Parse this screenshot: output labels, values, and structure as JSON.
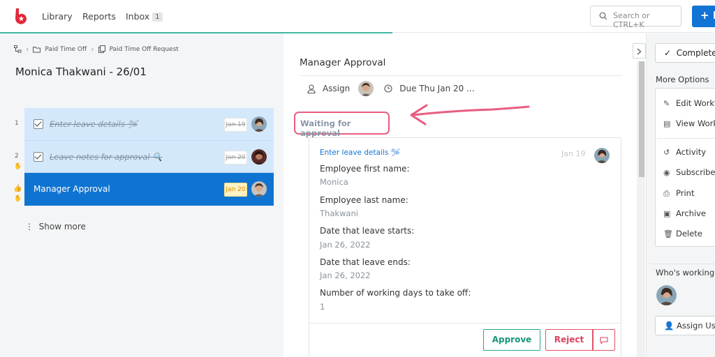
{
  "nav": {
    "library": "Library",
    "reports": "Reports",
    "inbox": "Inbox",
    "inbox_count": "1",
    "search_placeholder": "Search or CTRL+K",
    "new_button": "+ N"
  },
  "breadcrumb": {
    "items": [
      "Paid Time Off",
      "Paid Time Off Request"
    ]
  },
  "task": {
    "title": "Monica Thakwani - 26/01"
  },
  "steps": [
    {
      "num": "1",
      "label": "Enter leave details 🛩",
      "date": "Jan 19",
      "done": true
    },
    {
      "num": "2",
      "label": "Leave notes for approval 🔍",
      "date": "Jan 20",
      "done": true
    },
    {
      "num": "",
      "label": "Manager Approval",
      "date": "Jan 20",
      "done": false
    }
  ],
  "show_more": "Show more",
  "detail": {
    "section_title": "Manager Approval",
    "assign_label": "Assign",
    "due_label": "Due Thu Jan 20 ...",
    "waiting_label": "Waiting for approval",
    "form_head": "Enter leave details 🛩",
    "form_date": "Jan 19",
    "fields": [
      {
        "label": "Employee first name:",
        "value": "Monica"
      },
      {
        "label": "Employee last name:",
        "value": "Thakwani"
      },
      {
        "label": "Date that leave starts:",
        "value": "Jan 26, 2022"
      },
      {
        "label": "Date that leave ends:",
        "value": "Jan 26, 2022"
      },
      {
        "label": "Number of working days to take off:",
        "value": "1"
      }
    ],
    "approve": "Approve",
    "reject": "Reject"
  },
  "sidebar": {
    "complete": "Complete",
    "more_options": "More Options",
    "options": [
      "Edit Workf",
      "View Work",
      "Activity",
      "Subscribe",
      "Print",
      "Archive",
      "Delete"
    ],
    "who_working": "Who's working",
    "assign_user": "Assign Use"
  },
  "colors": {
    "primary": "#1173d4",
    "accent_green": "#3eb9a2",
    "highlight_pink": "#e85d80",
    "reject_red": "#d9435f"
  }
}
